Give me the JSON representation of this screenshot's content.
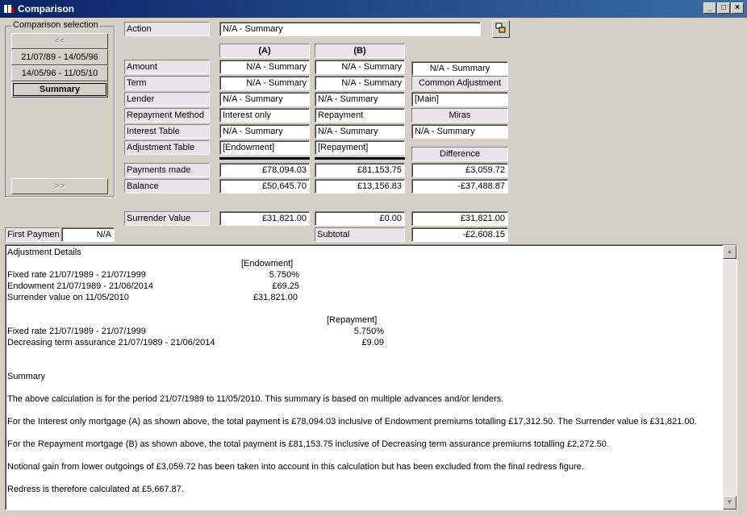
{
  "window": {
    "title": "Comparison"
  },
  "comparison_selection": {
    "legend": "Comparison selection",
    "prev": "<<",
    "next": ">>",
    "items": [
      "21/07/89 - 14/05/96",
      "14/05/96 - 11/05/10",
      "Summary"
    ]
  },
  "action": {
    "label": "Action",
    "value": "N/A - Summary"
  },
  "columns": {
    "a": "(A)",
    "b": "(B)"
  },
  "rows": {
    "amount": {
      "label": "Amount",
      "a": "N/A - Summary",
      "b": "N/A - Summary"
    },
    "term": {
      "label": "Term",
      "a": "N/A - Summary",
      "b": "N/A - Summary"
    },
    "lender": {
      "label": "Lender",
      "a": "N/A - Summary",
      "b": "N/A - Summary"
    },
    "repayment_method": {
      "label": "Repayment Method",
      "a": "Interest only",
      "b": "Repayment"
    },
    "interest_table": {
      "label": "Interest Table",
      "a": "N/A - Summary",
      "b": "N/A - Summary"
    },
    "adjustment_table": {
      "label": "Adjustment Table",
      "a": "[Endowment]",
      "b": "[Repayment]"
    },
    "payments_made": {
      "label": "Payments made",
      "a": "£78,094.03",
      "b": "£81,153.75",
      "diff": "£3,059.72"
    },
    "balance": {
      "label": "Balance",
      "a": "£50,645.70",
      "b": "£13,156.83",
      "diff": "-£37,488.87"
    },
    "surrender_value": {
      "label": "Surrender Value",
      "a": "£31,821.00",
      "b": "£0.00",
      "diff": "£31,821.00"
    }
  },
  "right": {
    "amount_value": "N/A - Summary",
    "common_adjustment_label": "Common Adjustment",
    "common_adjustment_value": "[Main]",
    "miras_label": "Miras",
    "miras_value": "N/A - Summary",
    "difference_label": "Difference"
  },
  "first_payment": {
    "label": "First Payment",
    "value": "N/A"
  },
  "subtotal": {
    "label": "Subtotal",
    "value": "-£2,608.15"
  },
  "details": {
    "heading": "Adjustment Details",
    "endowment_header": "[Endowment]",
    "endowment_lines": [
      {
        "text": "Fixed rate 21/07/1989 - 21/07/1999",
        "value": "5.750%"
      },
      {
        "text": "Endowment 21/07/1989 - 21/06/2014",
        "value": "£69.25"
      },
      {
        "text": "Surrender value on 11/05/2010",
        "value": "£31,821.00"
      }
    ],
    "repayment_header": "[Repayment]",
    "repayment_lines": [
      {
        "text": "Fixed rate 21/07/1989 - 21/07/1999",
        "value": "5.750%"
      },
      {
        "text": "Decreasing term assurance 21/07/1989 - 21/06/2014",
        "value": "£9.09"
      }
    ],
    "summary_heading": "Summary",
    "paragraphs": [
      "The above calculation is for the period 21/07/1989 to 11/05/2010. This summary is based on multiple advances and/or lenders.",
      "For the Interest only mortgage (A) as shown above, the total payment is £78,094.03 inclusive of Endowment premiums totalling £17,312.50. The Surrender value is £31,821.00.",
      "For the Repayment mortgage (B) as shown above, the total payment is £81,153.75 inclusive of Decreasing term assurance premiums totalling £2,272.50.",
      "Notional gain from lower outgoings of £3,059.72 has been taken into account in this calculation but has been excluded from the final redress figure.",
      "Redress is therefore calculated at £5,667.87."
    ]
  },
  "icons": {
    "app": "app-icon",
    "minimize": "minimize-icon",
    "maximize": "maximize-icon",
    "close": "close-icon",
    "action_lookup": "lookup-icon",
    "scroll_up": "scroll-up-icon",
    "scroll_down": "scroll-down-icon"
  }
}
